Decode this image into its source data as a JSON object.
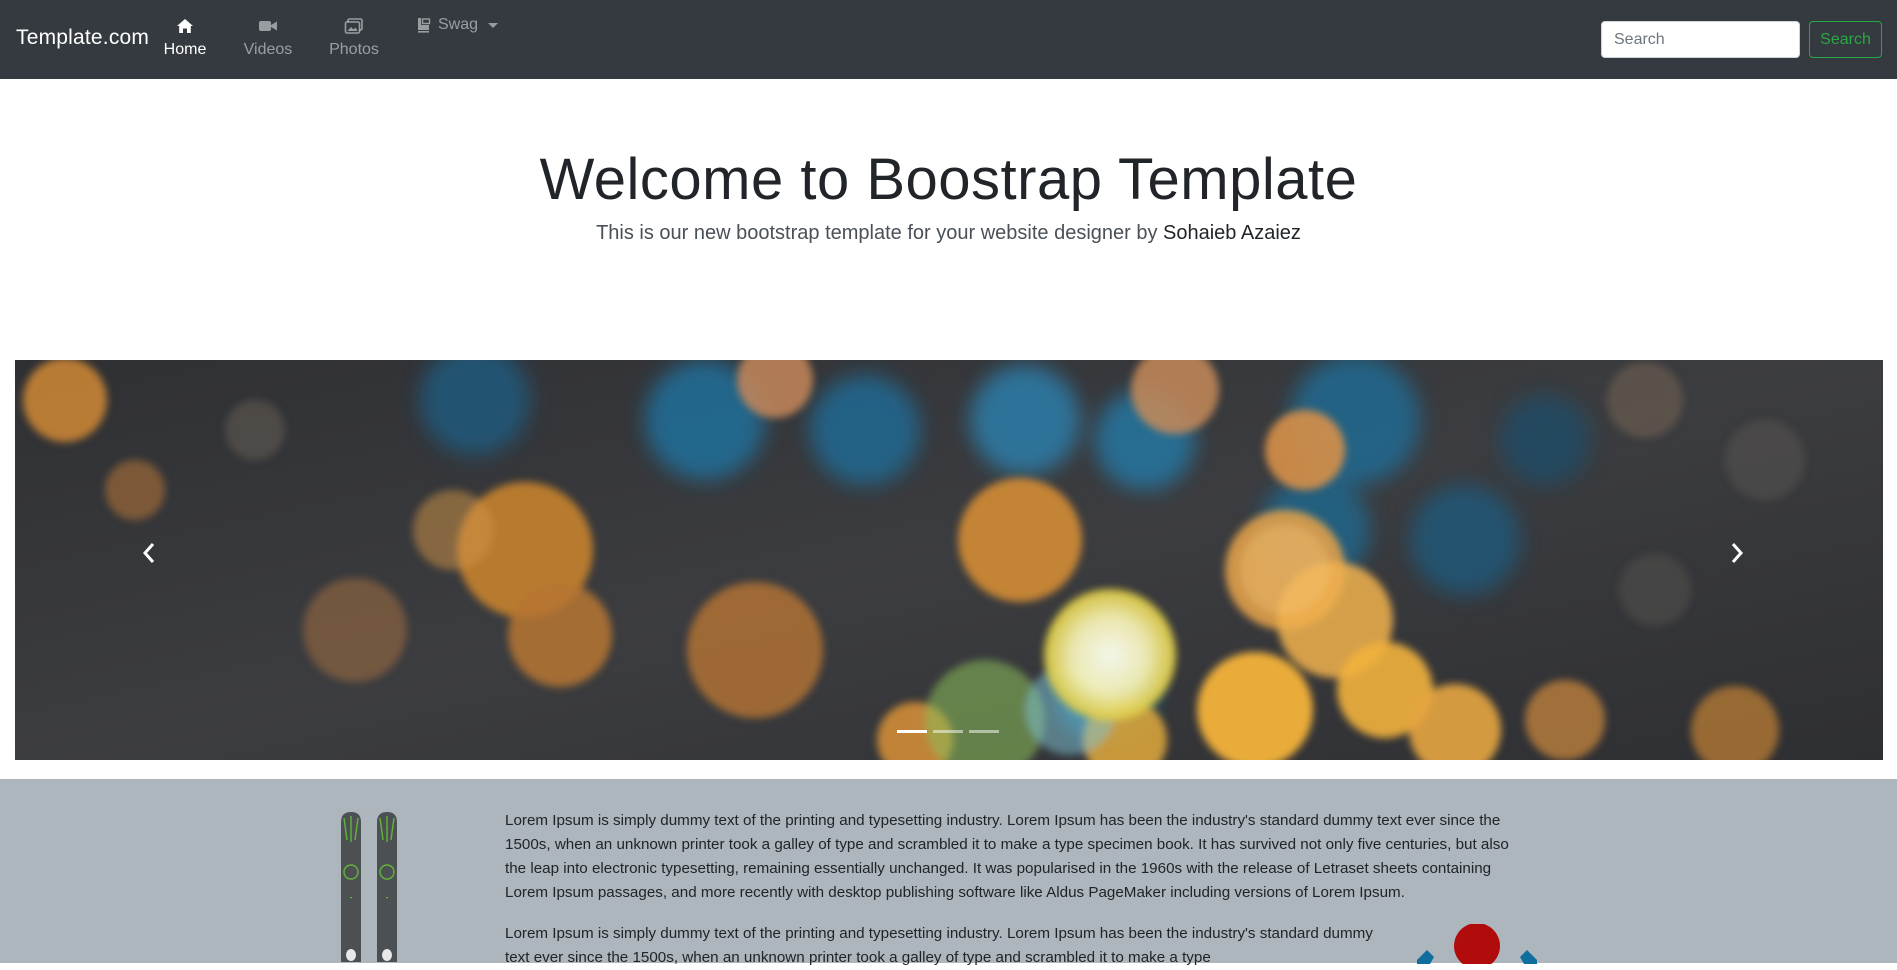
{
  "navbar": {
    "brand": "Template.com",
    "items": [
      {
        "label": "Home",
        "icon": "home-icon",
        "active": true
      },
      {
        "label": "Videos",
        "icon": "video-camera-icon",
        "active": false
      },
      {
        "label": "Photos",
        "icon": "photos-icon",
        "active": false
      },
      {
        "label": "Swag",
        "icon": "swag-icon",
        "active": false,
        "dropdown": true
      }
    ],
    "search": {
      "placeholder": "Search",
      "button_label": "Search"
    }
  },
  "hero": {
    "title": "Welcome to Boostrap Template",
    "subtitle": "This is our new bootstrap template for your website designer by",
    "author": "Sohaieb Azaiez"
  },
  "carousel": {
    "slide_count": 3,
    "active_index": 0,
    "prev_icon": "chevron-left-icon",
    "next_icon": "chevron-right-icon"
  },
  "content": {
    "paragraph1": "Lorem Ipsum is simply dummy text of the printing and typesetting industry. Lorem Ipsum has been the industry's standard dummy text ever since the 1500s, when an unknown printer took a galley of type and scrambled it to make a type specimen book. It has survived not only five centuries, but also the leap into electronic typesetting, remaining essentially unchanged. It was popularised in the 1960s with the release of Letraset sheets containing Lorem Ipsum passages, and more recently with desktop publishing software like Aldus PageMaker including versions of Lorem Ipsum.",
    "paragraph2": "Lorem Ipsum is simply dummy text of the printing and typesetting industry. Lorem Ipsum has been the industry's standard dummy text ever since the 1500s, when an unknown printer took a galley of type and scrambled it to make a type"
  },
  "colors": {
    "navbar_bg": "#343a40",
    "search_button": "#28a745",
    "content_bg": "#adb5bd"
  }
}
